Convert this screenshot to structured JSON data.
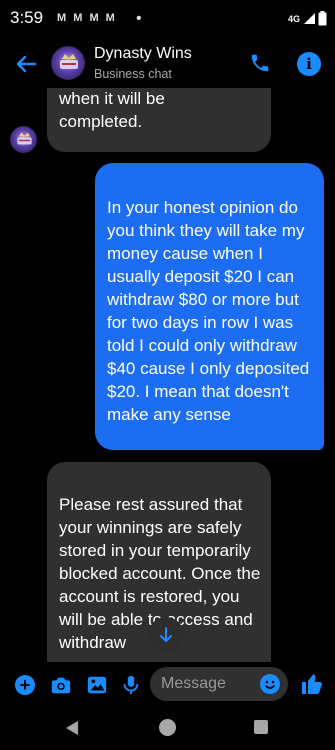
{
  "status": {
    "time": "3:59",
    "notif_icons": "M M M M",
    "dot": "•",
    "network": "4G"
  },
  "header": {
    "title": "Dynasty Wins",
    "subtitle": "Business chat"
  },
  "messages": [
    {
      "direction": "in",
      "text": "specific time frame for\nwhen it will be\ncompleted."
    },
    {
      "direction": "out",
      "text": "In your honest opinion do you think they will take my money cause when I usually deposit $20 I can withdraw $80 or more but for two days in row I was told I could only withdraw $40 cause I only deposited $20. I mean that doesn't make any sense"
    },
    {
      "direction": "in",
      "text": "Please rest assured that your winnings are safely stored in your temporarily blocked account. Once the account is restored, you will be able to access and withdraw"
    }
  ],
  "composer": {
    "placeholder": "Message"
  },
  "colors": {
    "accent": "#1a8cff",
    "outgoing_bubble": "#1c6df2",
    "incoming_bubble": "#303030"
  }
}
